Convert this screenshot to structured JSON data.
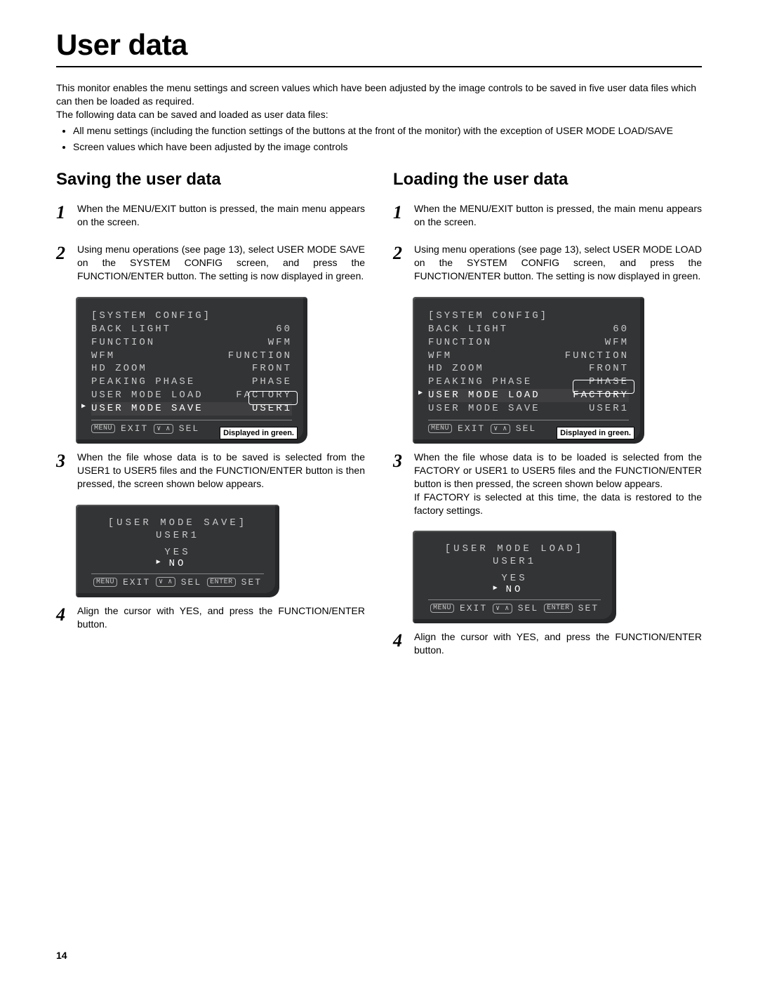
{
  "page_title": "User data",
  "intro_p1": "This monitor enables the menu settings and screen values which have been adjusted by the image controls to be saved in five user data files which can then be loaded as required.",
  "intro_p2": "The following data can be saved and loaded as user data files:",
  "intro_bullets": [
    "All menu settings (including the function settings of the buttons at the front of the monitor) with the exception of USER MODE LOAD/SAVE",
    "Screen values which have been adjusted by the image controls"
  ],
  "saving": {
    "heading": "Saving the user data",
    "steps": {
      "s1": "When the MENU/EXIT button is pressed, the main menu appears on the screen.",
      "s2": "Using menu operations (see page 13), select USER MODE SAVE on the SYSTEM CONFIG screen, and press the FUNCTION/ENTER button. The setting is now displayed in green.",
      "s3": "When the file whose data is to be saved is selected from the USER1 to USER5 files and the FUNCTION/ENTER button is then pressed, the screen shown below appears.",
      "s4": "Align the cursor with YES, and press the FUNCTION/ENTER button."
    },
    "osd1": {
      "title": "[SYSTEM CONFIG]",
      "rows": [
        {
          "l": "BACK LIGHT",
          "r": "60"
        },
        {
          "l": "FUNCTION",
          "r": "WFM"
        },
        {
          "l": "WFM",
          "r": "FUNCTION"
        },
        {
          "l": "HD ZOOM",
          "r": "FRONT"
        },
        {
          "l": "PEAKING PHASE",
          "r": "PHASE"
        },
        {
          "l": "USER MODE LOAD",
          "r": "FACTORY"
        },
        {
          "l": "USER MODE SAVE",
          "r": "USER1"
        }
      ],
      "footer_menu": "MENU",
      "footer_exit": "EXIT",
      "footer_sel_key": "∨ ∧",
      "footer_sel": "SEL",
      "callout": "Displayed in green."
    },
    "osd2": {
      "title": "[USER MODE SAVE]",
      "subtitle": "USER1",
      "yes": "YES",
      "no": "NO",
      "menu": "MENU",
      "exit": "EXIT",
      "selkey": "∨ ∧",
      "sel": "SEL",
      "enter": "ENTER",
      "set": "SET"
    }
  },
  "loading": {
    "heading": "Loading the user data",
    "steps": {
      "s1": "When the MENU/EXIT button is pressed, the main menu appears on the screen.",
      "s2": "Using menu operations (see page 13), select USER MODE LOAD on the SYSTEM CONFIG screen, and press the FUNCTION/ENTER button. The setting is now displayed in green.",
      "s3": "When the file whose data is to be loaded is selected from the FACTORY or USER1 to USER5 files and the FUNCTION/ENTER button is then pressed, the screen shown below appears.",
      "s3b": "If FACTORY is selected at this time, the data is restored to the factory settings.",
      "s4": "Align the cursor with YES, and press the FUNCTION/ENTER button."
    },
    "osd1": {
      "title": "[SYSTEM CONFIG]",
      "rows": [
        {
          "l": "BACK LIGHT",
          "r": "60"
        },
        {
          "l": "FUNCTION",
          "r": "WFM"
        },
        {
          "l": "WFM",
          "r": "FUNCTION"
        },
        {
          "l": "HD ZOOM",
          "r": "FRONT"
        },
        {
          "l": "PEAKING PHASE",
          "r": "PHASE"
        },
        {
          "l": "USER MODE LOAD",
          "r": "FACTORY"
        },
        {
          "l": "USER MODE SAVE",
          "r": "USER1"
        }
      ],
      "footer_menu": "MENU",
      "footer_exit": "EXIT",
      "footer_sel_key": "∨ ∧",
      "footer_sel": "SEL",
      "callout": "Displayed in green."
    },
    "osd2": {
      "title": "[USER MODE LOAD]",
      "subtitle": "USER1",
      "yes": "YES",
      "no": "NO",
      "menu": "MENU",
      "exit": "EXIT",
      "selkey": "∨ ∧",
      "sel": "SEL",
      "enter": "ENTER",
      "set": "SET"
    }
  },
  "page_number": "14"
}
